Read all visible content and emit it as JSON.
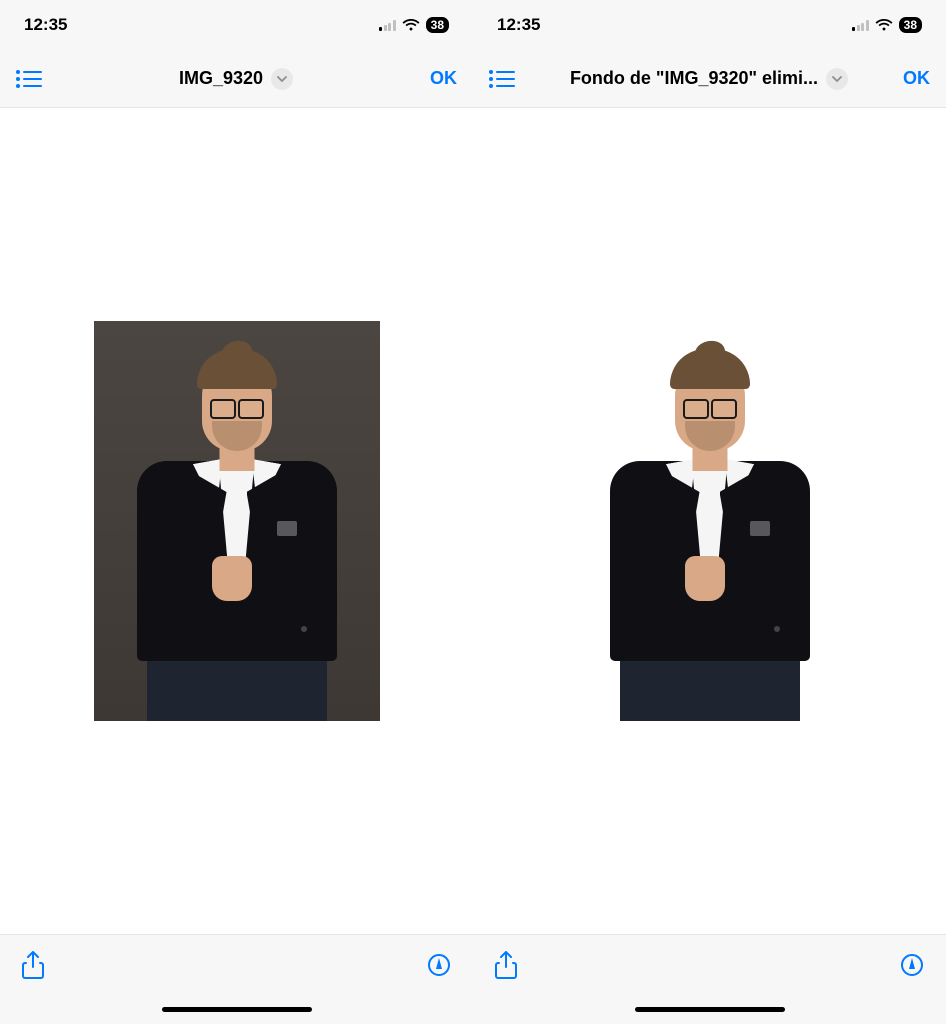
{
  "status": {
    "time": "12:35",
    "battery_percent": "38"
  },
  "left": {
    "nav": {
      "title": "IMG_9320",
      "ok_label": "OK"
    }
  },
  "right": {
    "nav": {
      "title": "Fondo de \"IMG_9320\" elimi...",
      "ok_label": "OK"
    }
  }
}
